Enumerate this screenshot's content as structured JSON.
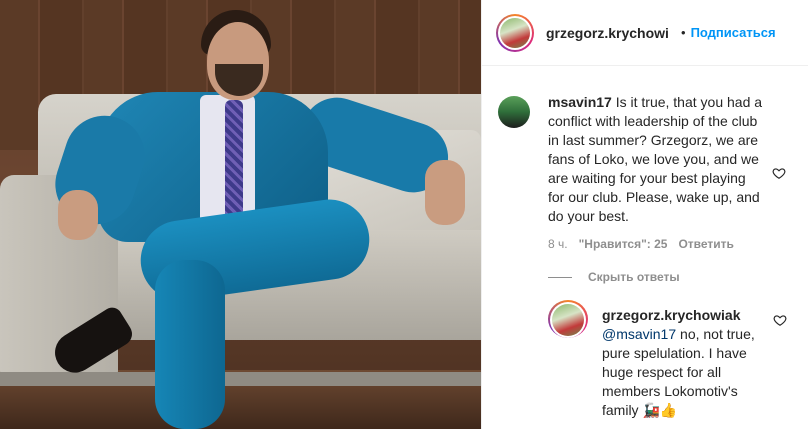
{
  "post": {
    "author": "grzegorz.krychowi",
    "separator": "•",
    "follow_label": "Подписаться"
  },
  "comment": {
    "username": "msavin17",
    "text": "Is it true, that you had a conflict with leadership of the club in last summer? Grzegorz, we are fans of Loko, we love you, and we are waiting for your best playing for our club. Please, wake up, and do your best.",
    "time": "8 ч.",
    "likes": "\"Нравится\": 25",
    "reply_label": "Ответить",
    "toggle_replies": "Скрыть ответы"
  },
  "reply": {
    "username": "grzegorz.krychowiak",
    "mention": "@msavin17",
    "text": " no, not true, pure spelulation. I have huge respect for all members Lokomotiv's family 🚂👍"
  },
  "colors": {
    "link_blue": "#0095f6",
    "mention_blue": "#00376b",
    "meta_gray": "#8e8e8e"
  },
  "icons": [
    "heart-icon",
    "train-emoji",
    "thumbs-up-emoji"
  ]
}
